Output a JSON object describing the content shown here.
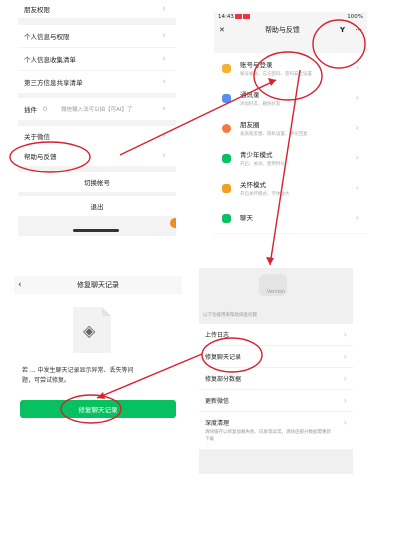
{
  "settings_panel": {
    "rows": [
      {
        "label": "朋友权限"
      },
      {
        "label": "个人信息与权限"
      },
      {
        "label": "个人信息收集清单"
      },
      {
        "label": "第三方信息共享清单"
      },
      {
        "label": "插件",
        "badge": "0",
        "value": "微信输入法可以拍【可AI】了"
      },
      {
        "label": "关于微信"
      },
      {
        "label": "帮助与反馈"
      }
    ],
    "switch_account": "切换帐号",
    "logout": "退出"
  },
  "help_panel": {
    "status_time": "14:43",
    "status_battery": "100%",
    "title": "帮助与反馈",
    "close_icon": "close-icon",
    "tool_icon": "wrench-icon",
    "more_icon": "more-icon",
    "items": [
      {
        "title": "账号与登录",
        "subtitle": "账号被盗、忘记密码、密码安全设置",
        "color": "#f2b233"
      },
      {
        "title": "通讯录",
        "subtitle": "添加好友、删除好友",
        "color": "#5b8def"
      },
      {
        "title": "朋友圈",
        "subtitle": "发表朋友圈、隐私设置、评论回复",
        "color": "#f07a3f"
      },
      {
        "title": "青少年模式",
        "subtitle": "开启、关闭、使用时长",
        "color": "#07c160"
      },
      {
        "title": "关怀模式",
        "subtitle": "开启关怀模式、字体放大",
        "color": "#f0a020"
      },
      {
        "title": "聊天",
        "subtitle": "",
        "color": "#07c160"
      }
    ]
  },
  "repair_panel": {
    "title": "修复聊天记录",
    "description": "若 ... 中发生聊天记录显示异常、丢失等问题，可尝试修复。",
    "button": "修复聊天记录"
  },
  "tools_panel": {
    "version": "Version",
    "hint": "以下功能用来帮助排查问题",
    "items": [
      {
        "label": "上传日志",
        "subtitle": ""
      },
      {
        "label": "修复聊天记录",
        "subtitle": ""
      },
      {
        "label": "修复部分数据",
        "subtitle": ""
      },
      {
        "label": "更新微信",
        "subtitle": ""
      },
      {
        "label": "深度清理",
        "subtitle": "清除缓存以修复加载失败、白屏等异常，清除后部分数据需重新下载"
      }
    ]
  },
  "colors": {
    "accent": "#07c160",
    "annotation": "#d8202e"
  }
}
